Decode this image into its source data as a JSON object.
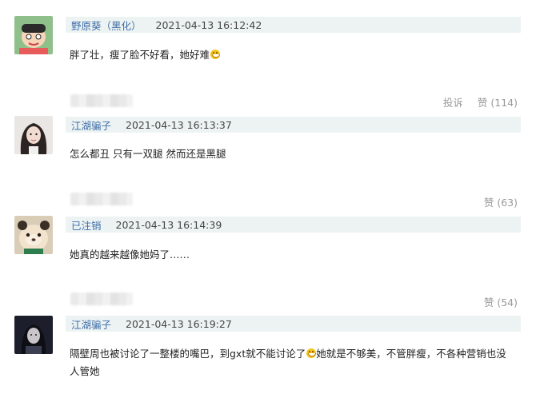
{
  "comments": [
    {
      "username": "野原葵（黑化）",
      "timestamp": "2021-04-13 16:12:42",
      "text": "胖了壮，瘦了脸不好看，她好难",
      "has_emoji": true,
      "report_label": "投诉",
      "like_label": "赞 (114)"
    },
    {
      "username": "江湖骗子",
      "timestamp": "2021-04-13 16:13:37",
      "text": "怎么都丑 只有一双腿 然而还是黑腿",
      "like_label": "赞 (63)"
    },
    {
      "username": "已注销",
      "timestamp": "2021-04-13 16:14:39",
      "text": "她真的越来越像她妈了……",
      "like_label": "赞 (54)"
    },
    {
      "username": "江湖骗子",
      "timestamp": "2021-04-13 16:19:27",
      "text_part1": "隔壁周也被讨论了一整楼的嘴巴，到gxt就不能讨论了",
      "text_part2": "她就是不够美，不管胖瘦，不各种营销也没人管她"
    }
  ],
  "colors": {
    "username": "#3f6ea8",
    "meta_bar": "#edf3f3",
    "action": "#999999"
  },
  "icons": [
    "smile-emoji-icon"
  ]
}
